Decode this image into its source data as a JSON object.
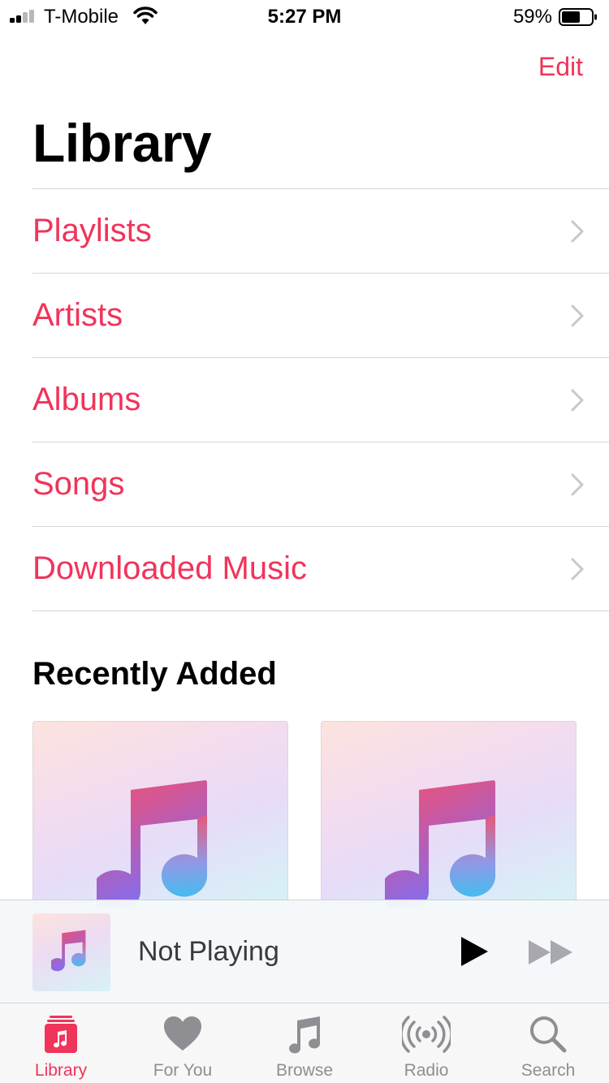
{
  "status_bar": {
    "carrier": "T-Mobile",
    "time": "5:27 PM",
    "battery": "59%"
  },
  "header": {
    "edit_label": "Edit",
    "title": "Library"
  },
  "menu": {
    "items": [
      {
        "label": "Playlists"
      },
      {
        "label": "Artists"
      },
      {
        "label": "Albums"
      },
      {
        "label": "Songs"
      },
      {
        "label": "Downloaded Music"
      }
    ]
  },
  "recently_added": {
    "title": "Recently Added"
  },
  "mini_player": {
    "status": "Not Playing"
  },
  "tab_bar": {
    "tabs": [
      {
        "label": "Library",
        "icon": "library-icon",
        "active": true
      },
      {
        "label": "For You",
        "icon": "heart-icon",
        "active": false
      },
      {
        "label": "Browse",
        "icon": "music-note-icon",
        "active": false
      },
      {
        "label": "Radio",
        "icon": "radio-icon",
        "active": false
      },
      {
        "label": "Search",
        "icon": "search-icon",
        "active": false
      }
    ]
  },
  "colors": {
    "accent": "#f0345a",
    "inactive": "#8e8e93"
  }
}
